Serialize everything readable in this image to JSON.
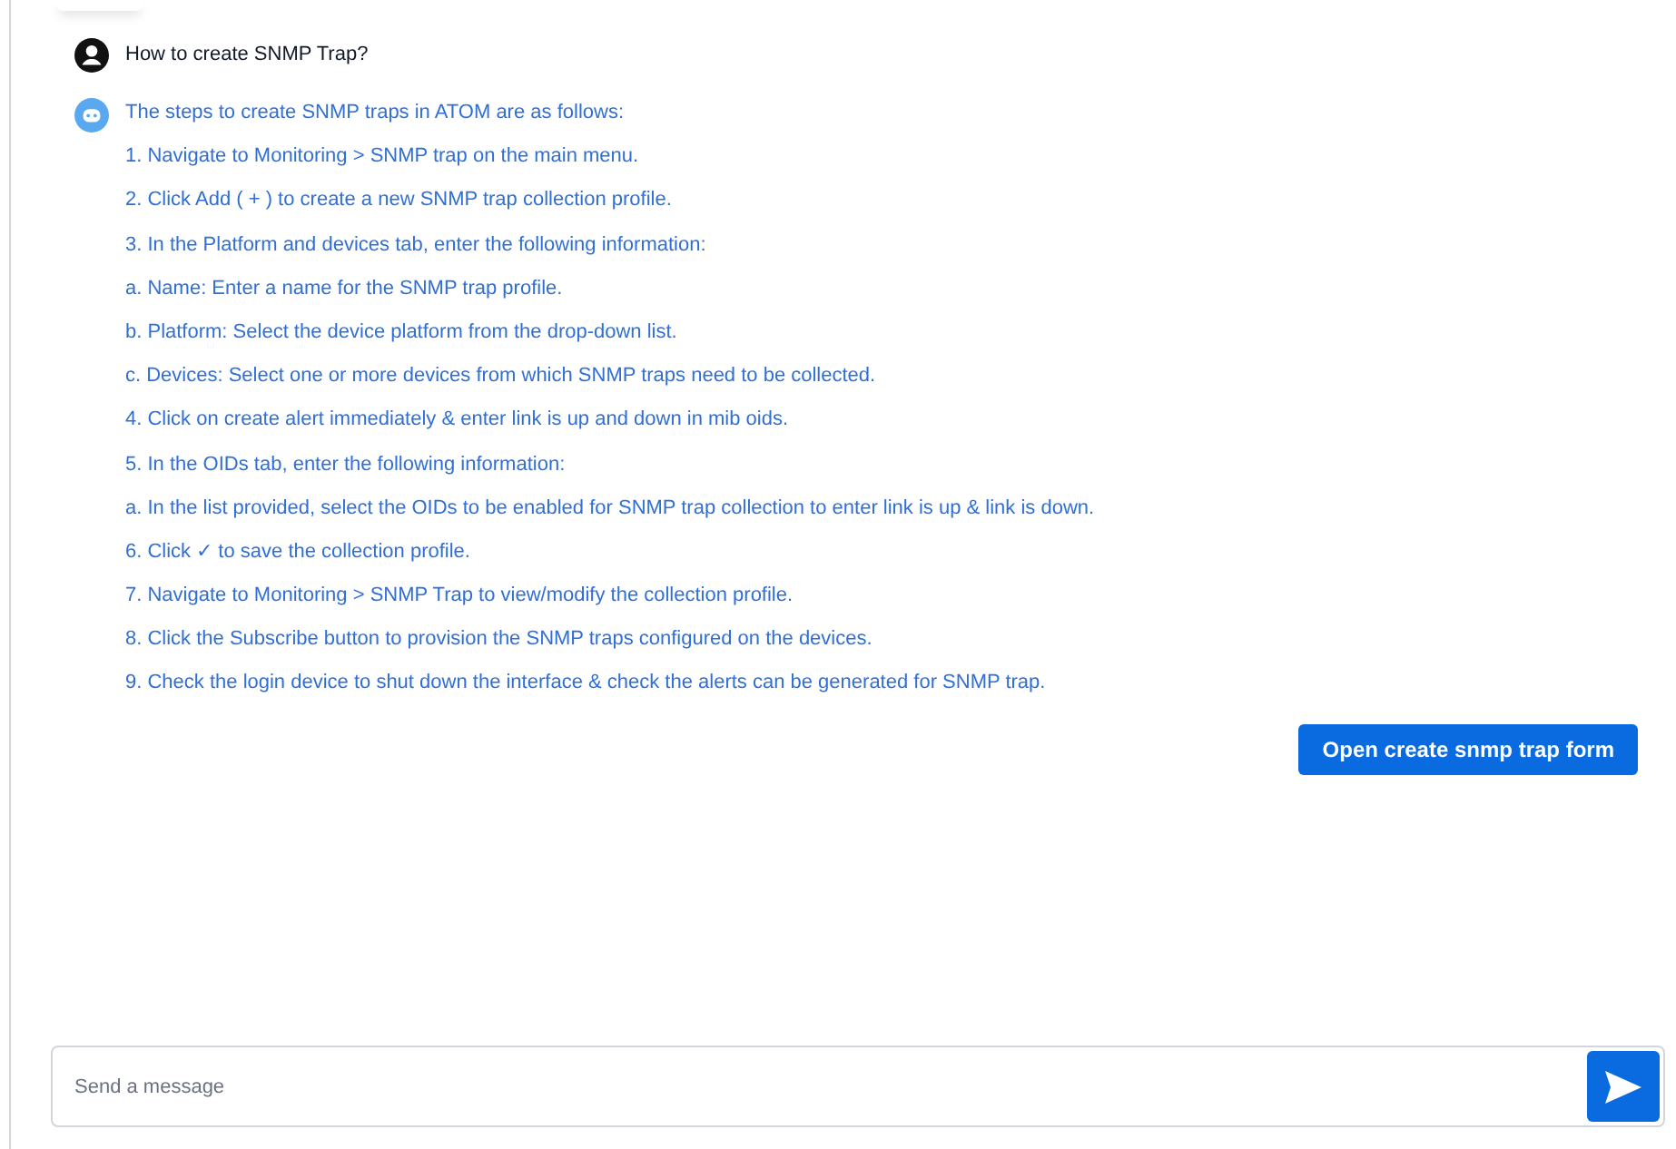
{
  "question": "How to create SNMP Trap?",
  "answer_lines": [
    "The steps to create SNMP traps in ATOM are as follows:",
    "1. Navigate to Monitoring > SNMP trap on the main menu.",
    "2. Click Add ( + ) to create a new SNMP trap collection profile.",
    "3. In the Platform and devices tab, enter the following information:",
    "a. Name: Enter a name for the SNMP trap profile.",
    "b. Platform: Select the device platform from the drop-down list.",
    "c. Devices: Select one or more devices from which SNMP traps need to be collected.",
    "4. Click on create alert immediately & enter link is up and down in mib oids.",
    "5. In the OIDs tab, enter the following information:",
    "a. In the list provided, select the OIDs to be enabled for SNMP trap collection to enter link is up & link is down.",
    "6. Click ✓ to save the collection profile.",
    "7. Navigate to Monitoring > SNMP Trap to view/modify the collection profile.",
    "8. Click the Subscribe button to provision the SNMP traps configured on the devices.",
    "9. Check the login device to shut down the interface & check the alerts can be generated for SNMP trap."
  ],
  "action_button": "Open create snmp trap form",
  "message_input": {
    "placeholder": "Send a message"
  }
}
